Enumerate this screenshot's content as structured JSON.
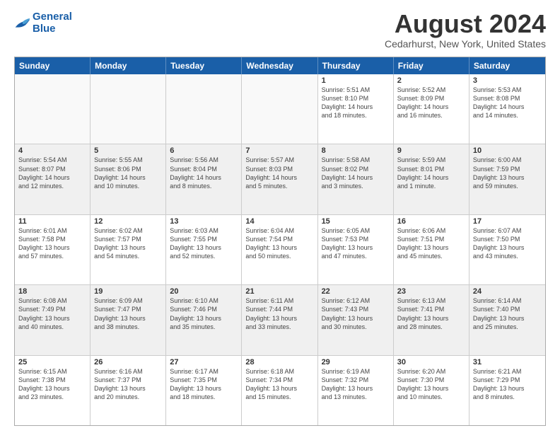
{
  "logo": {
    "line1": "General",
    "line2": "Blue"
  },
  "title": "August 2024",
  "subtitle": "Cedarhurst, New York, United States",
  "days": [
    "Sunday",
    "Monday",
    "Tuesday",
    "Wednesday",
    "Thursday",
    "Friday",
    "Saturday"
  ],
  "weeks": [
    [
      {
        "day": "",
        "content": ""
      },
      {
        "day": "",
        "content": ""
      },
      {
        "day": "",
        "content": ""
      },
      {
        "day": "",
        "content": ""
      },
      {
        "day": "1",
        "content": "Sunrise: 5:51 AM\nSunset: 8:10 PM\nDaylight: 14 hours\nand 18 minutes."
      },
      {
        "day": "2",
        "content": "Sunrise: 5:52 AM\nSunset: 8:09 PM\nDaylight: 14 hours\nand 16 minutes."
      },
      {
        "day": "3",
        "content": "Sunrise: 5:53 AM\nSunset: 8:08 PM\nDaylight: 14 hours\nand 14 minutes."
      }
    ],
    [
      {
        "day": "4",
        "content": "Sunrise: 5:54 AM\nSunset: 8:07 PM\nDaylight: 14 hours\nand 12 minutes."
      },
      {
        "day": "5",
        "content": "Sunrise: 5:55 AM\nSunset: 8:06 PM\nDaylight: 14 hours\nand 10 minutes."
      },
      {
        "day": "6",
        "content": "Sunrise: 5:56 AM\nSunset: 8:04 PM\nDaylight: 14 hours\nand 8 minutes."
      },
      {
        "day": "7",
        "content": "Sunrise: 5:57 AM\nSunset: 8:03 PM\nDaylight: 14 hours\nand 5 minutes."
      },
      {
        "day": "8",
        "content": "Sunrise: 5:58 AM\nSunset: 8:02 PM\nDaylight: 14 hours\nand 3 minutes."
      },
      {
        "day": "9",
        "content": "Sunrise: 5:59 AM\nSunset: 8:01 PM\nDaylight: 14 hours\nand 1 minute."
      },
      {
        "day": "10",
        "content": "Sunrise: 6:00 AM\nSunset: 7:59 PM\nDaylight: 13 hours\nand 59 minutes."
      }
    ],
    [
      {
        "day": "11",
        "content": "Sunrise: 6:01 AM\nSunset: 7:58 PM\nDaylight: 13 hours\nand 57 minutes."
      },
      {
        "day": "12",
        "content": "Sunrise: 6:02 AM\nSunset: 7:57 PM\nDaylight: 13 hours\nand 54 minutes."
      },
      {
        "day": "13",
        "content": "Sunrise: 6:03 AM\nSunset: 7:55 PM\nDaylight: 13 hours\nand 52 minutes."
      },
      {
        "day": "14",
        "content": "Sunrise: 6:04 AM\nSunset: 7:54 PM\nDaylight: 13 hours\nand 50 minutes."
      },
      {
        "day": "15",
        "content": "Sunrise: 6:05 AM\nSunset: 7:53 PM\nDaylight: 13 hours\nand 47 minutes."
      },
      {
        "day": "16",
        "content": "Sunrise: 6:06 AM\nSunset: 7:51 PM\nDaylight: 13 hours\nand 45 minutes."
      },
      {
        "day": "17",
        "content": "Sunrise: 6:07 AM\nSunset: 7:50 PM\nDaylight: 13 hours\nand 43 minutes."
      }
    ],
    [
      {
        "day": "18",
        "content": "Sunrise: 6:08 AM\nSunset: 7:49 PM\nDaylight: 13 hours\nand 40 minutes."
      },
      {
        "day": "19",
        "content": "Sunrise: 6:09 AM\nSunset: 7:47 PM\nDaylight: 13 hours\nand 38 minutes."
      },
      {
        "day": "20",
        "content": "Sunrise: 6:10 AM\nSunset: 7:46 PM\nDaylight: 13 hours\nand 35 minutes."
      },
      {
        "day": "21",
        "content": "Sunrise: 6:11 AM\nSunset: 7:44 PM\nDaylight: 13 hours\nand 33 minutes."
      },
      {
        "day": "22",
        "content": "Sunrise: 6:12 AM\nSunset: 7:43 PM\nDaylight: 13 hours\nand 30 minutes."
      },
      {
        "day": "23",
        "content": "Sunrise: 6:13 AM\nSunset: 7:41 PM\nDaylight: 13 hours\nand 28 minutes."
      },
      {
        "day": "24",
        "content": "Sunrise: 6:14 AM\nSunset: 7:40 PM\nDaylight: 13 hours\nand 25 minutes."
      }
    ],
    [
      {
        "day": "25",
        "content": "Sunrise: 6:15 AM\nSunset: 7:38 PM\nDaylight: 13 hours\nand 23 minutes."
      },
      {
        "day": "26",
        "content": "Sunrise: 6:16 AM\nSunset: 7:37 PM\nDaylight: 13 hours\nand 20 minutes."
      },
      {
        "day": "27",
        "content": "Sunrise: 6:17 AM\nSunset: 7:35 PM\nDaylight: 13 hours\nand 18 minutes."
      },
      {
        "day": "28",
        "content": "Sunrise: 6:18 AM\nSunset: 7:34 PM\nDaylight: 13 hours\nand 15 minutes."
      },
      {
        "day": "29",
        "content": "Sunrise: 6:19 AM\nSunset: 7:32 PM\nDaylight: 13 hours\nand 13 minutes."
      },
      {
        "day": "30",
        "content": "Sunrise: 6:20 AM\nSunset: 7:30 PM\nDaylight: 13 hours\nand 10 minutes."
      },
      {
        "day": "31",
        "content": "Sunrise: 6:21 AM\nSunset: 7:29 PM\nDaylight: 13 hours\nand 8 minutes."
      }
    ]
  ]
}
